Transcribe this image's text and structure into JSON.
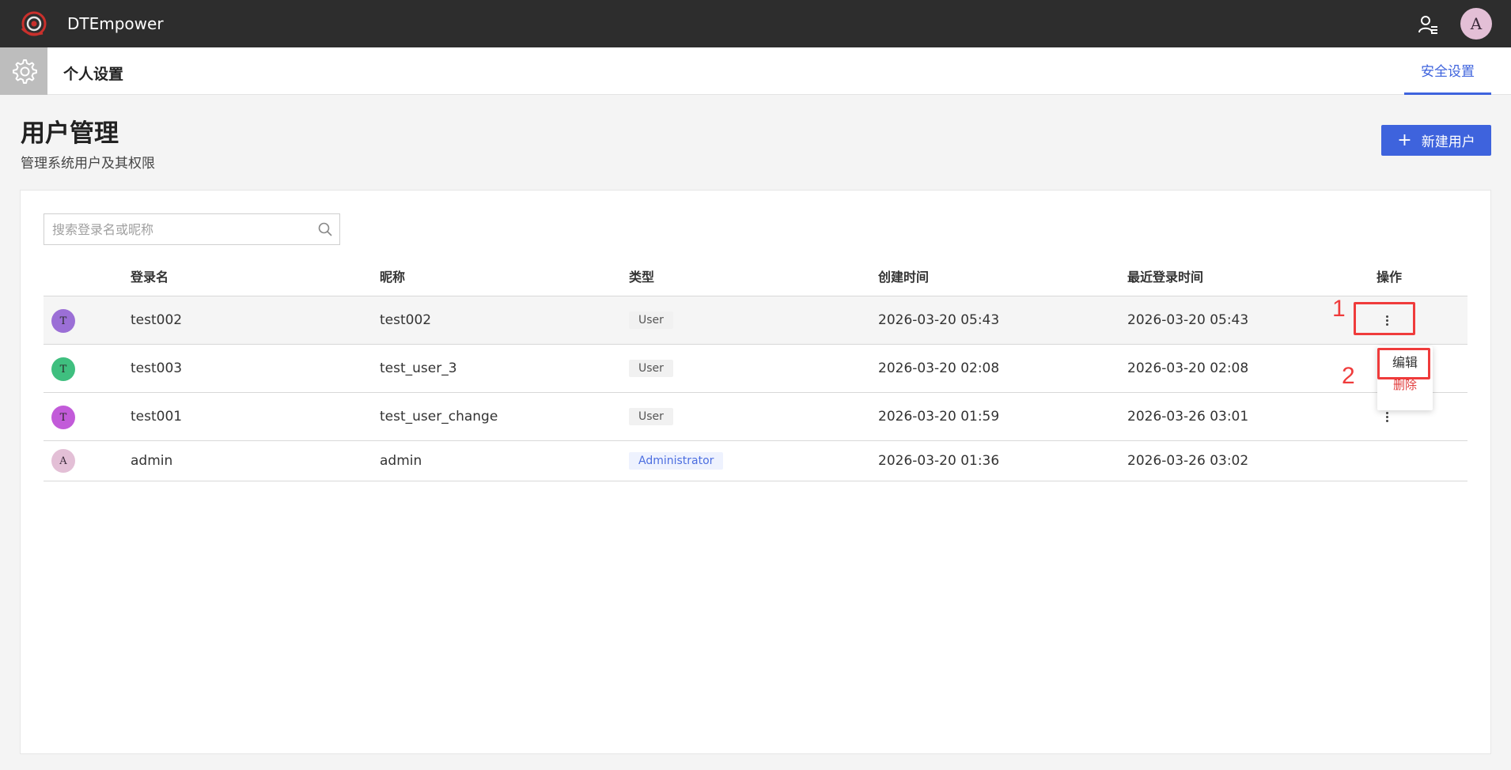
{
  "app": {
    "title": "DTEmpower"
  },
  "topbar": {
    "avatar_letter": "A"
  },
  "subheader": {
    "title": "个人设置",
    "tab_security": "安全设置"
  },
  "page": {
    "title": "用户管理",
    "subtitle": "管理系统用户及其权限",
    "new_user_button": "新建用户"
  },
  "search": {
    "placeholder": "搜索登录名或昵称",
    "value": ""
  },
  "table": {
    "columns": [
      "登录名",
      "昵称",
      "类型",
      "创建时间",
      "最近登录时间",
      "操作"
    ],
    "rows": [
      {
        "avatar_letter": "T",
        "avatar_color": "#9b6fd6",
        "login": "test002",
        "nickname": "test002",
        "type": "User",
        "created": "2026-03-20 05:43",
        "last_login": "2026-03-20 05:43"
      },
      {
        "avatar_letter": "T",
        "avatar_color": "#3fbf7f",
        "login": "test003",
        "nickname": "test_user_3",
        "type": "User",
        "created": "2026-03-20 02:08",
        "last_login": "2026-03-20 02:08"
      },
      {
        "avatar_letter": "T",
        "avatar_color": "#c25bd9",
        "login": "test001",
        "nickname": "test_user_change",
        "type": "User",
        "created": "2026-03-20 01:59",
        "last_login": "2026-03-26 03:01"
      },
      {
        "avatar_letter": "A",
        "avatar_color": "#e3bfd6",
        "login": "admin",
        "nickname": "admin",
        "type": "Administrator",
        "created": "2026-03-20 01:36",
        "last_login": "2026-03-26 03:02"
      }
    ]
  },
  "dropdown": {
    "edit": "编辑",
    "delete": "删除"
  },
  "annotations": {
    "one": "1",
    "two": "2"
  },
  "colors": {
    "accent": "#3e63dd",
    "danger": "#e03c3c",
    "annotation": "#ef3b3b",
    "topbar": "#2d2d2d"
  }
}
